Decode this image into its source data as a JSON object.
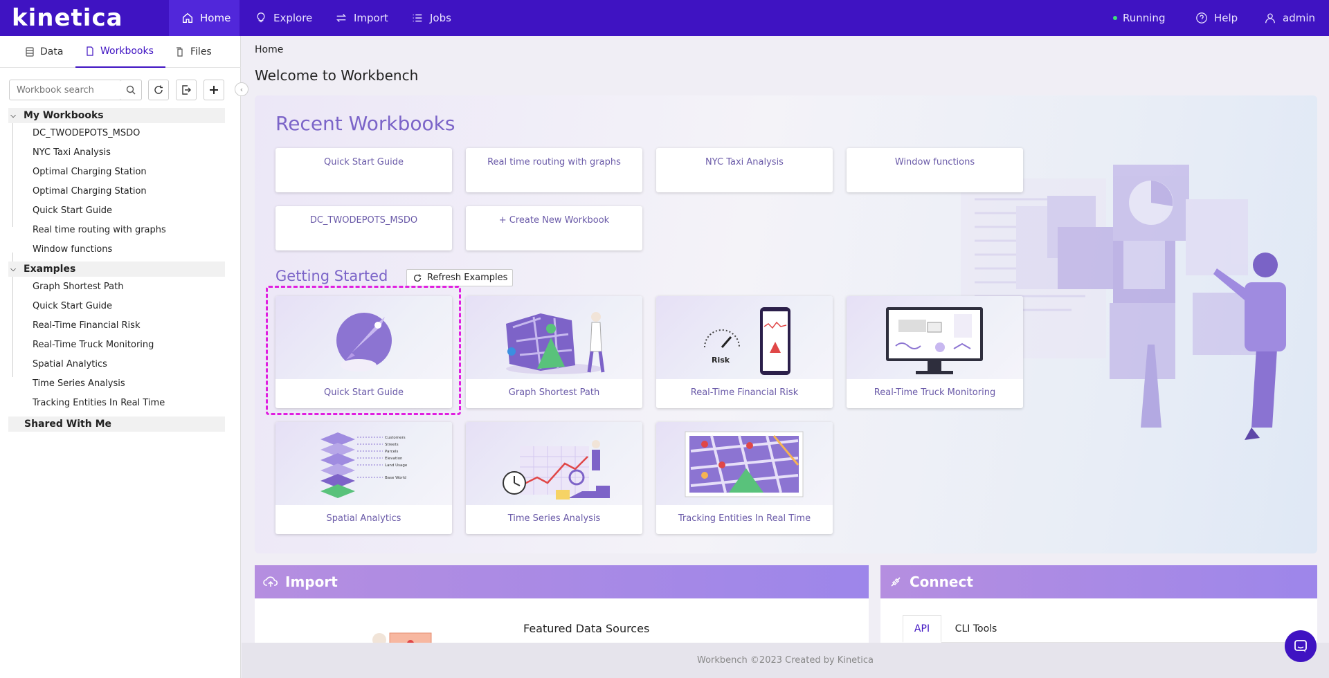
{
  "app": {
    "logo": "kinetica"
  },
  "topnav": {
    "items": [
      {
        "label": "Home",
        "icon": "home-icon"
      },
      {
        "label": "Explore",
        "icon": "lightbulb-icon"
      },
      {
        "label": "Import",
        "icon": "swap-icon"
      },
      {
        "label": "Jobs",
        "icon": "list-icon"
      }
    ],
    "status": "Running",
    "help": "Help",
    "user": "admin"
  },
  "sidebar": {
    "tabs": [
      {
        "label": "Data"
      },
      {
        "label": "Workbooks"
      },
      {
        "label": "Files"
      }
    ],
    "search_placeholder": "Workbook search",
    "my_workbooks": {
      "title": "My Workbooks",
      "items": [
        "DC_TWODEPOTS_MSDO",
        "NYC Taxi Analysis",
        "Optimal Charging Station",
        "Optimal Charging Station",
        "Quick Start Guide",
        "Real time routing with graphs",
        "Window functions"
      ]
    },
    "examples": {
      "title": "Examples",
      "items": [
        "Graph Shortest Path",
        "Quick Start Guide",
        "Real-Time Financial Risk",
        "Real-Time Truck Monitoring",
        "Spatial Analytics",
        "Time Series Analysis",
        "Tracking Entities In Real Time"
      ]
    },
    "shared": {
      "title": "Shared With Me"
    }
  },
  "main": {
    "breadcrumb": "Home",
    "title": "Welcome to Workbench",
    "recent": {
      "title": "Recent Workbooks",
      "items": [
        "Quick Start Guide",
        "Real time routing with graphs",
        "NYC Taxi Analysis",
        "Window functions",
        "DC_TWODEPOTS_MSDO"
      ],
      "create_label": "+ Create New Workbook"
    },
    "getting_started": {
      "title": "Getting Started",
      "refresh_label": "Refresh Examples",
      "cards": [
        "Quick Start Guide",
        "Graph Shortest Path",
        "Real-Time Financial Risk",
        "Real-Time Truck Monitoring",
        "Spatial Analytics",
        "Time Series Analysis",
        "Tracking Entities In Real Time"
      ],
      "risk_label": "Risk",
      "spatial_layers": [
        "Customers",
        "Streets",
        "Parcels",
        "Elevation",
        "Land Usage",
        "Base World"
      ]
    },
    "import": {
      "title": "Import",
      "featured": "Featured Data Sources"
    },
    "connect": {
      "title": "Connect",
      "tabs": [
        "API",
        "CLI Tools"
      ]
    }
  },
  "footer": {
    "text": "Workbench ©2023 Created by Kinetica"
  },
  "colors": {
    "brand": "#3f13c2",
    "accent": "#7b64c8",
    "highlight": "#e01ee0"
  }
}
